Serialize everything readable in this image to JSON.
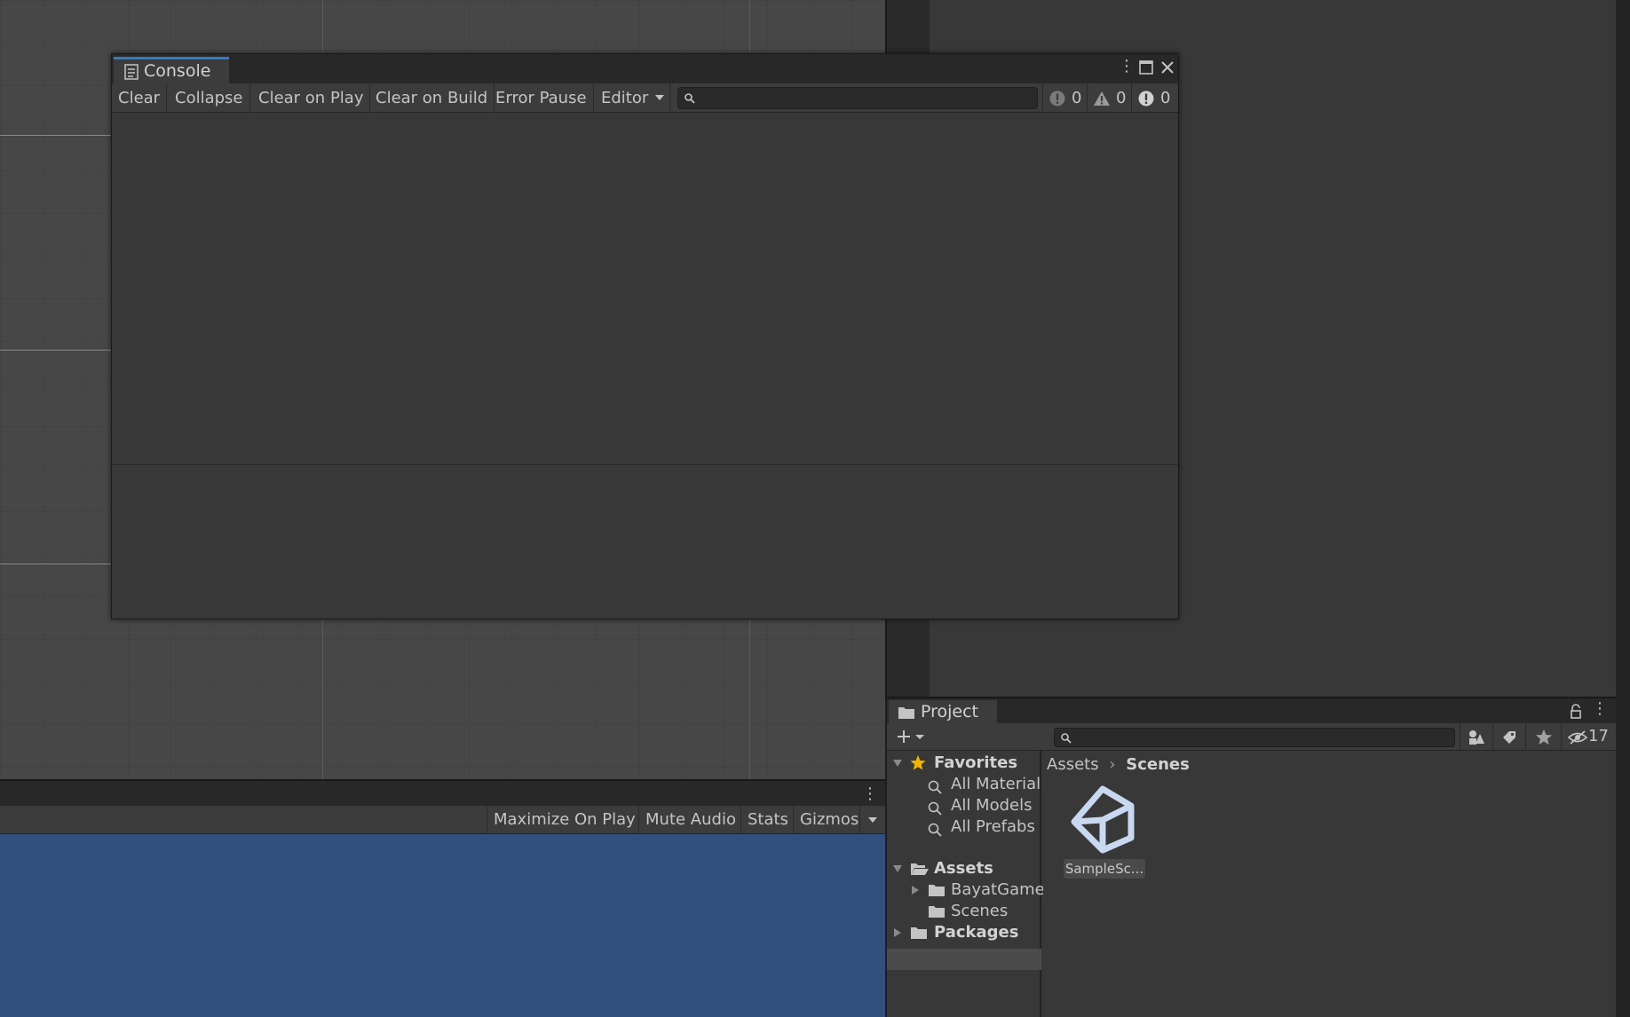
{
  "console": {
    "tab_title": "Console",
    "toolbar": {
      "clear": "Clear",
      "collapse": "Collapse",
      "clear_on_play": "Clear on Play",
      "clear_on_build": "Clear on Build",
      "error_pause": "Error Pause",
      "editor": "Editor"
    },
    "search_placeholder": "",
    "counts": {
      "errors": "0",
      "warnings": "0",
      "messages": "0"
    }
  },
  "game": {
    "toolbar": {
      "maximize_on_play": "Maximize On Play",
      "mute_audio": "Mute Audio",
      "stats": "Stats",
      "gizmos": "Gizmos"
    },
    "background_color": "#31507d"
  },
  "project": {
    "tab_title": "Project",
    "hidden_count": "17",
    "search_placeholder": "",
    "tree": {
      "favorites": "Favorites",
      "fav_items": [
        "All Material",
        "All Models",
        "All Prefabs"
      ],
      "assets": "Assets",
      "asset_items": [
        "BayatGame",
        "Scenes"
      ],
      "packages": "Packages"
    },
    "breadcrumb": {
      "root": "Assets",
      "current": "Scenes"
    },
    "files": [
      {
        "name": "SampleSc...",
        "icon": "unity-logo-icon"
      }
    ]
  },
  "colors": {
    "accent_tab": "#3a79bb",
    "favorites_star": "#f0b400"
  }
}
